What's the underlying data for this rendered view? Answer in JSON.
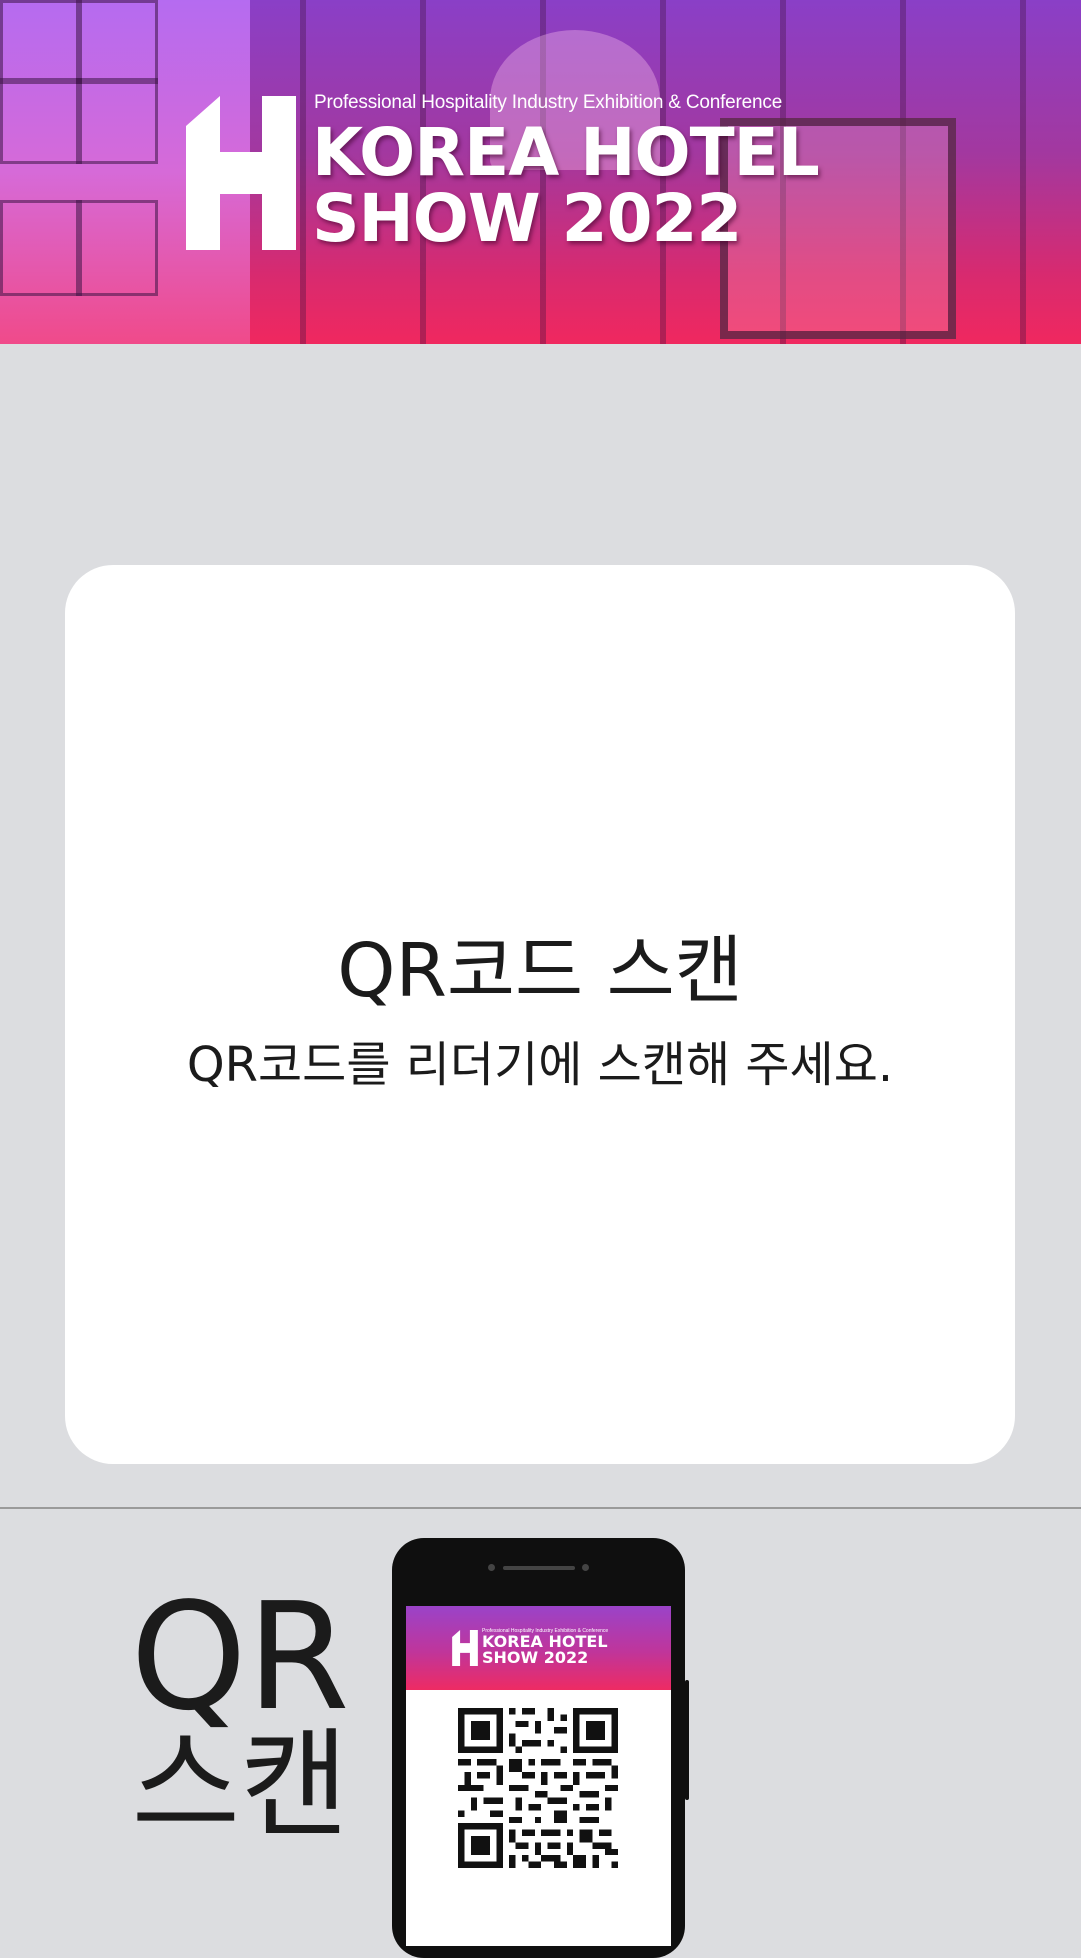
{
  "banner": {
    "tagline": "Professional Hospitality Industry Exhibition & Conference",
    "title_line1": "KOREA HOTEL",
    "title_line2": "SHOW 2022",
    "logo_letter": "H",
    "colors": {
      "top": "#8a3fc7",
      "bottom": "#f0285f"
    }
  },
  "card": {
    "title": "QR코드 스캔",
    "subtitle": "QR코드를 리더기에 스캔해 주세요."
  },
  "bottom": {
    "label_line1": "QR",
    "label_line2": "스캔",
    "phone": {
      "tagline": "Professional Hospitality Industry Exhibition & Conference",
      "title_line1": "KOREA HOTEL",
      "title_line2": "SHOW 2022"
    }
  }
}
